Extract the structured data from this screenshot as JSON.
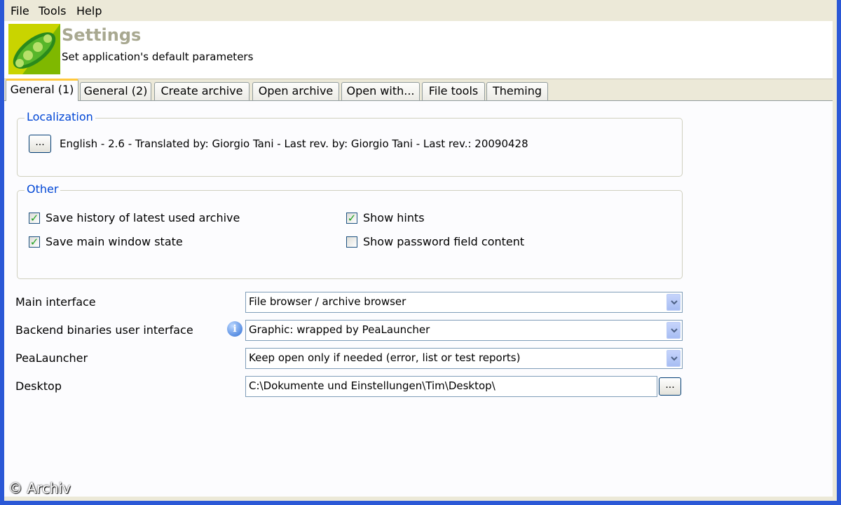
{
  "menu": [
    "File",
    "Tools",
    "Help"
  ],
  "header": {
    "title": "Settings",
    "subtitle": "Set application's default parameters"
  },
  "tabs": [
    {
      "label": "General (1)",
      "active": true
    },
    {
      "label": "General (2)",
      "active": false
    },
    {
      "label": "Create archive",
      "active": false
    },
    {
      "label": "Open archive",
      "active": false
    },
    {
      "label": "Open with...",
      "active": false
    },
    {
      "label": "File tools",
      "active": false
    },
    {
      "label": "Theming",
      "active": false
    }
  ],
  "localization": {
    "legend": "Localization",
    "button_label": "...",
    "info": "English - 2.6 - Translated by: Giorgio Tani - Last rev. by: Giorgio Tani - Last rev.: 20090428"
  },
  "other": {
    "legend": "Other",
    "checkboxes": [
      {
        "label": "Save history of latest used archive",
        "checked": true
      },
      {
        "label": "Show hints",
        "checked": true
      },
      {
        "label": "Save main window state",
        "checked": true
      },
      {
        "label": "Show password field content",
        "checked": false
      }
    ]
  },
  "settings": {
    "main_interface": {
      "label": "Main interface",
      "value": "File browser / archive browser"
    },
    "backend": {
      "label": "Backend binaries user interface",
      "value": "Graphic: wrapped by PeaLauncher"
    },
    "pealauncher": {
      "label": "PeaLauncher",
      "value": "Keep open only if needed (error, list or test reports)"
    },
    "desktop": {
      "label": "Desktop",
      "value": "C:\\Dokumente und Einstellungen\\Tim\\Desktop\\",
      "browse_label": "..."
    }
  },
  "watermark": "© Archiv",
  "colors": {
    "legend_text": "#0046d5",
    "active_tab_accent": "#ffc83c",
    "title_text": "#a8a890",
    "check_mark": "#21a121"
  }
}
